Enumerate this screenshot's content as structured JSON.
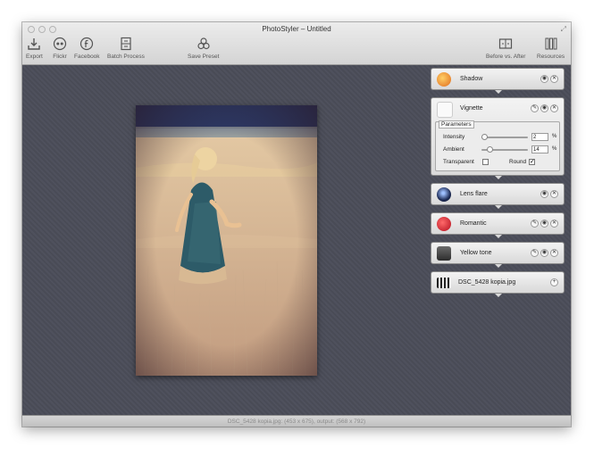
{
  "window": {
    "title": "PhotoStyler – Untitled"
  },
  "toolbar": {
    "left": [
      {
        "label": "Export",
        "icon": "export-icon"
      },
      {
        "label": "Flickr",
        "icon": "flickr-icon"
      },
      {
        "label": "Facebook",
        "icon": "facebook-icon"
      },
      {
        "label": "Batch Process",
        "icon": "batch-process-icon"
      },
      {
        "label": "Save Preset",
        "icon": "save-preset-icon"
      }
    ],
    "right": [
      {
        "label": "Before vs. After",
        "icon": "before-after-icon"
      },
      {
        "label": "Resources",
        "icon": "resources-icon"
      }
    ]
  },
  "effects": [
    {
      "name": "Shadow",
      "icon": "shadow-effect-icon"
    },
    {
      "name": "Vignette",
      "icon": "vignette-effect-icon"
    },
    {
      "name": "Lens flare",
      "icon": "lens-flare-icon"
    },
    {
      "name": "Romantic",
      "icon": "romantic-icon"
    },
    {
      "name": "Yellow tone",
      "icon": "yellow-tone-icon"
    },
    {
      "name": "DSC_5428 kopia.jpg",
      "icon": "source-image-icon"
    }
  ],
  "vignette_params": {
    "title": "Parameters",
    "intensity": {
      "label": "Intensity",
      "value": "2",
      "unit": "%",
      "slider_level": 0.02
    },
    "ambient": {
      "label": "Ambient",
      "value": "14",
      "unit": "%",
      "slider_level": 0.14
    },
    "transparent": {
      "label": "Transparent",
      "checked": false
    },
    "round": {
      "label": "Round",
      "checked": true
    }
  },
  "status": {
    "text": "DSC_5428 kopia.jpg: (453 x 675), output: (568 x 792)"
  },
  "colors": {
    "canvas": "#4b4d59",
    "toolbar": "#dcdcdc",
    "statusbar": "#c9c9c9",
    "effect_card": "#e4e4e4"
  }
}
